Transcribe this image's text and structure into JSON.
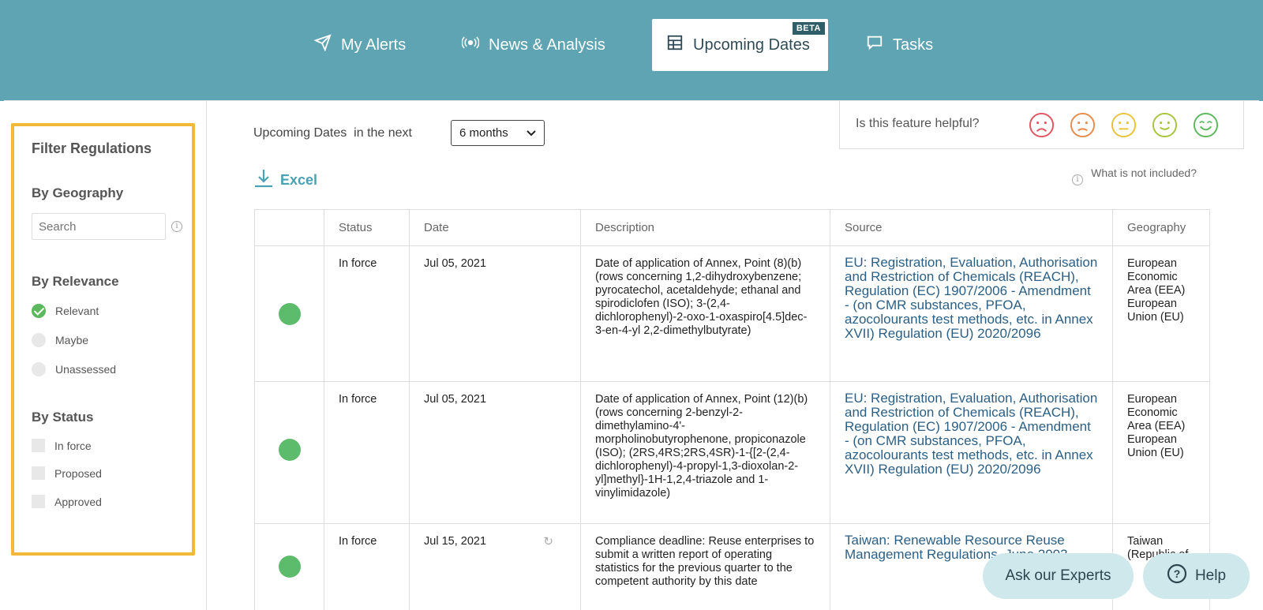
{
  "nav": {
    "tabs": [
      {
        "label": "My Alerts",
        "icon": "send-icon"
      },
      {
        "label": "News & Analysis",
        "icon": "broadcast-icon"
      },
      {
        "label": "Upcoming Dates",
        "icon": "table-icon",
        "active": true,
        "badge": "BETA"
      },
      {
        "label": "Tasks",
        "icon": "chat-icon"
      }
    ]
  },
  "filters": {
    "title": "Filter Regulations",
    "geography": {
      "heading": "By Geography",
      "placeholder": "Search"
    },
    "relevance": {
      "heading": "By Relevance",
      "options": [
        {
          "label": "Relevant",
          "checked": true
        },
        {
          "label": "Maybe",
          "checked": false
        },
        {
          "label": "Unassessed",
          "checked": false
        }
      ]
    },
    "status": {
      "heading": "By Status",
      "options": [
        {
          "label": "In force",
          "checked": false
        },
        {
          "label": "Proposed",
          "checked": false
        },
        {
          "label": "Approved",
          "checked": false
        }
      ]
    }
  },
  "controls": {
    "upcoming_label": "Upcoming Dates",
    "next_label": "in the next",
    "range_value": "6 months",
    "excel_label": "Excel",
    "what_not_included": "What is not included?"
  },
  "feedback": {
    "question": "Is this feature helpful?",
    "faces": [
      "very-sad-face-icon",
      "sad-face-icon",
      "neutral-face-icon",
      "happy-face-icon",
      "very-happy-face-icon"
    ],
    "colors": [
      "#e0555f",
      "#e88a4a",
      "#e8c23a",
      "#a8c43a",
      "#5cb85c"
    ]
  },
  "table": {
    "columns": [
      "",
      "Status",
      "Date",
      "Description",
      "Source",
      "Geography"
    ],
    "rows": [
      {
        "status": "In force",
        "date": "Jul 05, 2021",
        "description": "Date of application of Annex, Point (8)(b) (rows concerning 1,2-dihydroxybenzene; pyrocatechol, acetaldehyde; ethanal and spirodiclofen (ISO); 3-(2,4-dichlorophenyl)-2-oxo-1-oxaspiro[4.5]dec-3-en-4-yl 2,2-dimethylbutyrate)",
        "source": "EU: Registration, Evaluation, Authorisation and Restriction of Chemicals (REACH), Regulation (EC) 1907/2006 - Amendment - (on CMR substances, PFOA, azocolourants test methods, etc. in Annex XVII) Regulation (EU) 2020/2096",
        "geography": "European Economic Area (EEA) European Union (EU)"
      },
      {
        "status": "In force",
        "date": "Jul 05, 2021",
        "description": "Date of application of Annex, Point (12)(b) (rows concerning 2-benzyl-2-dimethylamino-4'-morpholinobutyrophenone, propiconazole (ISO); (2RS,4RS;2RS,4SR)-1-{[2-(2,4-dichlorophenyl)-4-propyl-1,3-dioxolan-2-yl]methyl}-1H-1,2,4-triazole and 1-vinylimidazole)",
        "source": "EU: Registration, Evaluation, Authorisation and Restriction of Chemicals (REACH), Regulation (EC) 1907/2006 - Amendment - (on CMR substances, PFOA, azocolourants test methods, etc. in Annex XVII) Regulation (EU) 2020/2096",
        "geography": "European Economic Area (EEA) European Union (EU)"
      },
      {
        "status": "In force",
        "date": "Jul 15, 2021",
        "description": "Compliance deadline: Reuse enterprises to submit a written report of operating statistics for the previous quarter to the competent authority by this date",
        "source": "Taiwan: Renewable Resource Reuse Management Regulations, June 2003",
        "geography": "Taiwan (Republic of"
      }
    ]
  },
  "floating": {
    "experts_label": "Ask our Experts",
    "help_label": "Help"
  }
}
